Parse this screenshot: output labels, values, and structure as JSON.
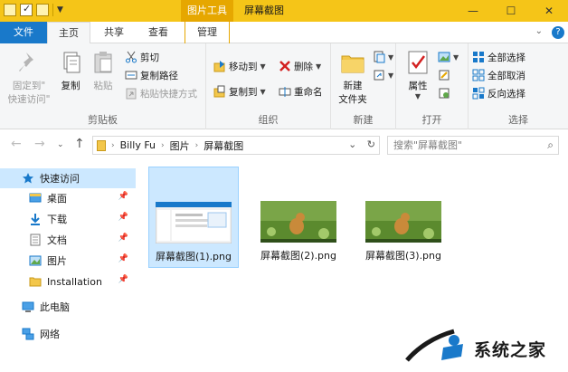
{
  "title_bar": {
    "context_tab": "图片工具",
    "window_title": "屏幕截图",
    "controls": [
      "—",
      "☐",
      "✕"
    ]
  },
  "tabs": {
    "file": "文件",
    "home": "主页",
    "share": "共享",
    "view": "查看",
    "manage": "管理"
  },
  "ribbon": {
    "clipboard": {
      "pin": "固定到\"快速访问\"",
      "pin_line1": "固定到\"",
      "pin_line2": "快速访问\"",
      "copy": "复制",
      "paste": "粘贴",
      "cut": "剪切",
      "copy_path": "复制路径",
      "paste_shortcut": "粘贴快捷方式",
      "label": "剪贴板"
    },
    "organize": {
      "move_to": "移动到",
      "copy_to": "复制到",
      "delete": "删除",
      "rename": "重命名",
      "label": "组织"
    },
    "new": {
      "new_folder_line1": "新建",
      "new_folder_line2": "文件夹",
      "label": "新建"
    },
    "open": {
      "properties": "属性",
      "label": "打开"
    },
    "select": {
      "select_all": "全部选择",
      "select_none": "全部取消",
      "invert": "反向选择",
      "label": "选择"
    }
  },
  "address": {
    "crumbs": [
      "Billy Fu",
      "图片",
      "屏幕截图"
    ],
    "search_placeholder": "搜索\"屏幕截图\""
  },
  "nav_pane": {
    "quick_access": "快速访问",
    "items": [
      {
        "label": "桌面",
        "pinned": true
      },
      {
        "label": "下载",
        "pinned": true
      },
      {
        "label": "文档",
        "pinned": true
      },
      {
        "label": "图片",
        "pinned": true
      },
      {
        "label": "Installation",
        "pinned": true
      }
    ],
    "this_pc": "此电脑",
    "network": "网络"
  },
  "files": [
    {
      "name": "屏幕截图(1).png",
      "selected": true
    },
    {
      "name": "屏幕截图(2).png",
      "selected": false
    },
    {
      "name": "屏幕截图(3).png",
      "selected": false
    }
  ],
  "watermark": {
    "text": "系统之家"
  },
  "colors": {
    "title_yellow": "#f5c518",
    "context_amber": "#e6a700",
    "file_tab_blue": "#1979ca",
    "selection": "#cce8ff"
  }
}
